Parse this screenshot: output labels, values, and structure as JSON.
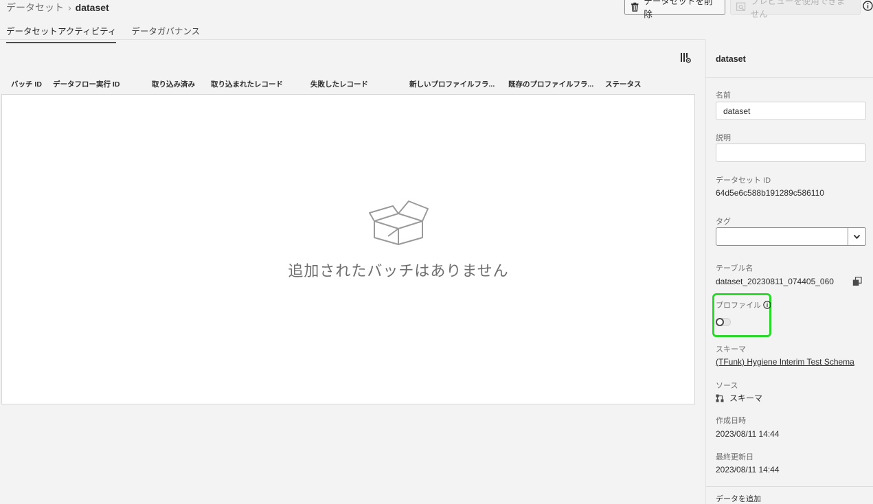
{
  "breadcrumb": {
    "parent": "データセット",
    "separator": "›",
    "current": "dataset"
  },
  "actions": {
    "delete_label": "データセットを削除",
    "preview_label": "プレビューを使用できません"
  },
  "tabs": [
    {
      "label": "データセットアクティビティ"
    },
    {
      "label": "データガバナンス"
    }
  ],
  "table": {
    "columns": [
      "バッチ ID",
      "データフロー実行 ID",
      "取り込み済み",
      "取り込まれたレコード",
      "失敗したレコード",
      "新しいプロファイルフラ...",
      "既存のプロファイルフラ...",
      "ステータス"
    ],
    "empty_message": "追加されたバッチはありません"
  },
  "panel": {
    "title": "dataset",
    "name_label": "名前",
    "name_value": "dataset",
    "description_label": "説明",
    "description_value": "",
    "dataset_id_label": "データセット ID",
    "dataset_id_value": "64d5e6c588b191289c586110",
    "tags_label": "タグ",
    "table_name_label": "テーブル名",
    "table_name_value": "dataset_20230811_074405_060",
    "profile_label": "プロファイル",
    "profile_enabled": false,
    "schema_label": "スキーマ",
    "schema_value": "(TFunk) Hygiene Interim Test Schema",
    "source_label": "ソース",
    "source_value": "スキーマ",
    "created_label": "作成日時",
    "created_value": "2023/08/11 14:44",
    "modified_label": "最終更新日",
    "modified_value": "2023/08/11 14:44",
    "add_data_label": "データを追加"
  },
  "colors": {
    "highlight": "#2bd92b",
    "text": "#2c2c2c",
    "muted": "#6e6e6e"
  }
}
